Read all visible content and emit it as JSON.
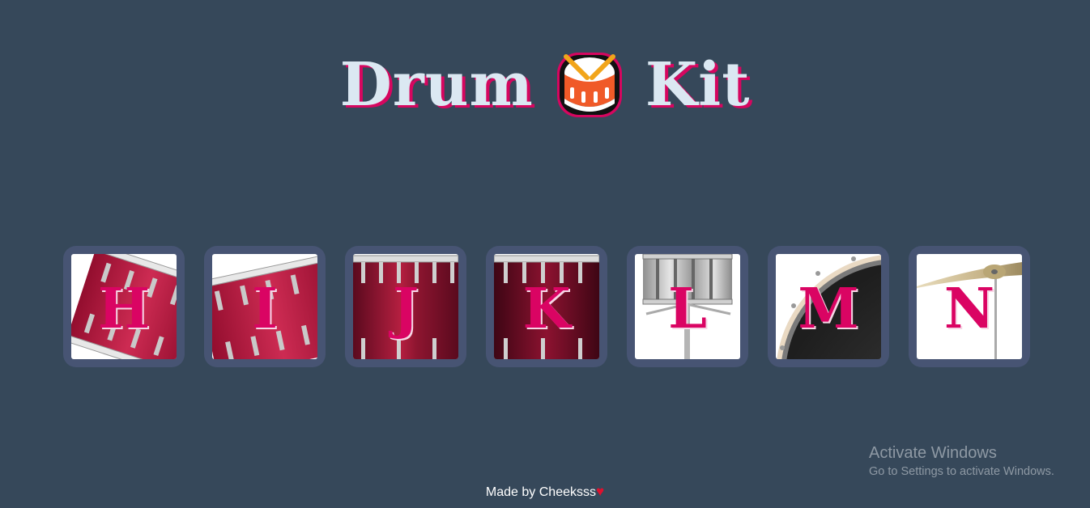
{
  "header": {
    "title_left": "Drum",
    "title_right": "Kit",
    "logo_icon": "drum-icon"
  },
  "drums": [
    {
      "key": "H",
      "style": "tilted-red-tom"
    },
    {
      "key": "I",
      "style": "tilted-red-tom"
    },
    {
      "key": "J",
      "style": "red-snare"
    },
    {
      "key": "K",
      "style": "dark-red-snare"
    },
    {
      "key": "L",
      "style": "chrome-snare-on-stand"
    },
    {
      "key": "M",
      "style": "bass-drum"
    },
    {
      "key": "N",
      "style": "crash-cymbal"
    }
  ],
  "footer": {
    "text": "Made by Cheeksss",
    "heart_icon": "heart-icon"
  },
  "watermark": {
    "title": "Activate Windows",
    "subtitle": "Go to Settings to activate Windows."
  },
  "colors": {
    "background": "#36485a",
    "button_frame": "#475473",
    "letter": "#da0463",
    "title_text": "#dbe8f2",
    "title_shadow": "#d6065f"
  }
}
